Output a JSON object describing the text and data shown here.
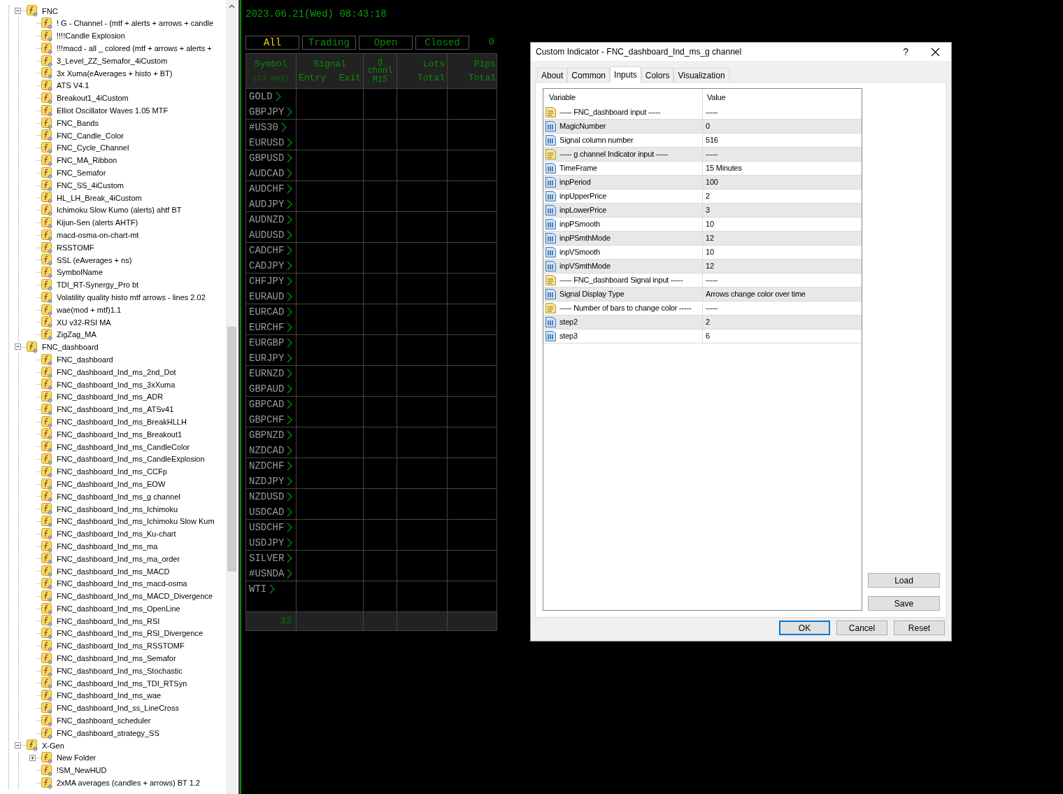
{
  "navigator": {
    "tree": [
      {
        "label": "FNC",
        "expanded": true,
        "children": [
          {
            "label": "! G - Channel - (mtf + alerts + arrows + candle"
          },
          {
            "label": "!!!!Candle Explosion"
          },
          {
            "label": "!!!macd - all _ colored (mtf + arrows + alerts +"
          },
          {
            "label": "3_Level_ZZ_Semafor_4iCustom"
          },
          {
            "label": "3x Xuma(eAverages + histo + BT)"
          },
          {
            "label": "ATS V4.1"
          },
          {
            "label": "Breakout1_4iCustom"
          },
          {
            "label": "Elliot Oscillator Waves 1.05 MTF"
          },
          {
            "label": "FNC_Bands"
          },
          {
            "label": "FNC_Candle_Color"
          },
          {
            "label": "FNC_Cycle_Channel"
          },
          {
            "label": "FNC_MA_Ribbon"
          },
          {
            "label": "FNC_Semafor"
          },
          {
            "label": "FNC_SS_4iCustom"
          },
          {
            "label": "HL_LH_Break_4iCustom"
          },
          {
            "label": "Ichimoku Slow Kumo (alerts) ahtf BT"
          },
          {
            "label": "Kijun-Sen (alerts AHTF)"
          },
          {
            "label": "macd-osma-on-chart-mt"
          },
          {
            "label": "RSSTOMF"
          },
          {
            "label": "SSL (eAverages + ns)"
          },
          {
            "label": "SymbolName"
          },
          {
            "label": "TDI_RT-Synergy_Pro bt"
          },
          {
            "label": "Volatility quality histo mtf arrows - lines 2.02"
          },
          {
            "label": "wae(mod + mtf)1.1"
          },
          {
            "label": "XU v32-RSI MA"
          },
          {
            "label": "ZigZag_MA"
          }
        ]
      },
      {
        "label": "FNC_dashboard",
        "expanded": true,
        "children": [
          {
            "label": "FNC_dashboard"
          },
          {
            "label": "FNC_dashboard_Ind_ms_2nd_Dot"
          },
          {
            "label": "FNC_dashboard_Ind_ms_3xXuma"
          },
          {
            "label": "FNC_dashboard_Ind_ms_ADR"
          },
          {
            "label": "FNC_dashboard_Ind_ms_ATSv41"
          },
          {
            "label": "FNC_dashboard_Ind_ms_BreakHLLH"
          },
          {
            "label": "FNC_dashboard_Ind_ms_Breakout1"
          },
          {
            "label": "FNC_dashboard_Ind_ms_CandleColor"
          },
          {
            "label": "FNC_dashboard_Ind_ms_CandleExplosion"
          },
          {
            "label": "FNC_dashboard_Ind_ms_CCFp"
          },
          {
            "label": "FNC_dashboard_Ind_ms_EOW"
          },
          {
            "label": "FNC_dashboard_Ind_ms_g channel"
          },
          {
            "label": "FNC_dashboard_Ind_ms_Ichimoku"
          },
          {
            "label": "FNC_dashboard_Ind_ms_Ichimoku Slow Kum"
          },
          {
            "label": "FNC_dashboard_Ind_ms_Ku-chart"
          },
          {
            "label": "FNC_dashboard_Ind_ms_ma"
          },
          {
            "label": "FNC_dashboard_Ind_ms_ma_order"
          },
          {
            "label": "FNC_dashboard_Ind_ms_MACD"
          },
          {
            "label": "FNC_dashboard_Ind_ms_macd-osma"
          },
          {
            "label": "FNC_dashboard_Ind_ms_MACD_Divergence"
          },
          {
            "label": "FNC_dashboard_Ind_ms_OpenLine"
          },
          {
            "label": "FNC_dashboard_Ind_ms_RSI"
          },
          {
            "label": "FNC_dashboard_Ind_ms_RSI_Divergence"
          },
          {
            "label": "FNC_dashboard_Ind_ms_RSSTOMF"
          },
          {
            "label": "FNC_dashboard_Ind_ms_Semafor"
          },
          {
            "label": "FNC_dashboard_Ind_ms_Stochastic"
          },
          {
            "label": "FNC_dashboard_Ind_ms_TDI_RTSyn"
          },
          {
            "label": "FNC_dashboard_Ind_ms_wae"
          },
          {
            "label": "FNC_dashboard_Ind_ss_LineCross"
          },
          {
            "label": "FNC_dashboard_scheduler"
          },
          {
            "label": "FNC_dashboard_strategy_SS"
          }
        ]
      },
      {
        "label": "X-Gen",
        "expanded": true,
        "children": [
          {
            "label": "New Folder",
            "expanded": false
          },
          {
            "label": "!SM_NewHUD"
          },
          {
            "label": "2xMA averages (candles + arrows) BT 1.2"
          }
        ]
      }
    ]
  },
  "dashboard": {
    "datetime": "2023.06.21(Wed) 08:43:18",
    "filters": [
      {
        "label": "All",
        "selected": true
      },
      {
        "label": "Trading",
        "selected": false
      },
      {
        "label": "Open",
        "selected": false
      },
      {
        "label": "Closed",
        "selected": false
      }
    ],
    "trade_count": "0",
    "columns": [
      {
        "lines": [
          [
            "Symbol"
          ]
        ],
        "note": "(23.065)"
      },
      {
        "lines": [
          [
            "Signal"
          ],
          [
            "Entry",
            "Exit"
          ]
        ]
      },
      {
        "lines": [
          [
            "g"
          ],
          [
            "chnnl"
          ],
          [
            "M15"
          ]
        ]
      },
      {
        "lines": [
          [
            "Lots"
          ],
          [
            "Total"
          ]
        ]
      },
      {
        "lines": [
          [
            "Pips"
          ],
          [
            "Total"
          ]
        ]
      }
    ],
    "symbols": [
      "GOLD",
      "GBPJPY",
      "#US30",
      "EURUSD",
      "GBPUSD",
      "AUDCAD",
      "AUDCHF",
      "AUDJPY",
      "AUDNZD",
      "AUDUSD",
      "CADCHF",
      "CADJPY",
      "CHFJPY",
      "EURAUD",
      "EURCAD",
      "EURCHF",
      "EURGBP",
      "EURJPY",
      "EURNZD",
      "GBPAUD",
      "GBPCAD",
      "GBPCHF",
      "GBPNZD",
      "NZDCAD",
      "NZDCHF",
      "NZDJPY",
      "NZDUSD",
      "USDCAD",
      "USDCHF",
      "USDJPY",
      "SILVER",
      "#USNDA",
      "WTI"
    ],
    "symbol_total": "33"
  },
  "dialog": {
    "title": "Custom Indicator - FNC_dashboard_Ind_ms_g channel",
    "help": "?",
    "tabs": [
      {
        "label": "About",
        "selected": false
      },
      {
        "label": "Common",
        "selected": false
      },
      {
        "label": "Inputs",
        "selected": true
      },
      {
        "label": "Colors",
        "selected": false
      },
      {
        "label": "Visualization",
        "selected": false
      }
    ],
    "columns": [
      "Variable",
      "Value"
    ],
    "rows": [
      {
        "kind": "string",
        "variable": "----- FNC_dashboard input -----",
        "value": "-----"
      },
      {
        "kind": "number",
        "variable": "MagicNumber",
        "value": "0"
      },
      {
        "kind": "number",
        "variable": "Signal column number",
        "value": "516"
      },
      {
        "kind": "string",
        "variable": "----- g channel Indicator input -----",
        "value": "-----"
      },
      {
        "kind": "number",
        "variable": "TimeFrame",
        "value": "15 Minutes"
      },
      {
        "kind": "number",
        "variable": "inpPeriod",
        "value": "100"
      },
      {
        "kind": "number",
        "variable": "inpUpperPrice",
        "value": "2"
      },
      {
        "kind": "number",
        "variable": "inpLowerPrice",
        "value": "3"
      },
      {
        "kind": "number",
        "variable": "inpPSmooth",
        "value": "10"
      },
      {
        "kind": "number",
        "variable": "inpPSmthMode",
        "value": "12"
      },
      {
        "kind": "number",
        "variable": "inpVSmooth",
        "value": "10"
      },
      {
        "kind": "number",
        "variable": "inpVSmthMode",
        "value": "12"
      },
      {
        "kind": "string",
        "variable": "----- FNC_dashboard Signal input -----",
        "value": "-----"
      },
      {
        "kind": "number",
        "variable": "Signal Display Type",
        "value": "Arrows change color over time"
      },
      {
        "kind": "string",
        "variable": "----- Number of bars to change color -----",
        "value": "-----"
      },
      {
        "kind": "number",
        "variable": "step2",
        "value": "2"
      },
      {
        "kind": "number",
        "variable": "step3",
        "value": "6"
      }
    ],
    "side_buttons": [
      "Load",
      "Save"
    ],
    "buttons": [
      {
        "label": "OK",
        "default": true
      },
      {
        "label": "Cancel",
        "default": false
      },
      {
        "label": "Reset",
        "default": false
      }
    ]
  }
}
